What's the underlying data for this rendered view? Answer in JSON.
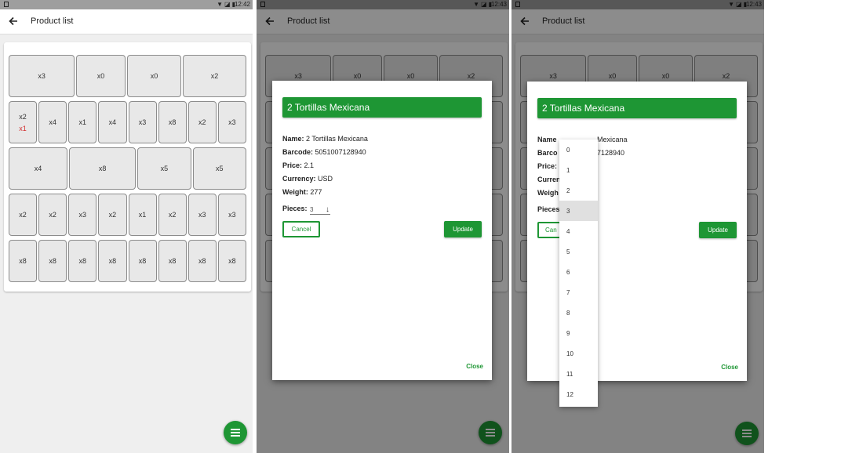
{
  "status_bar": {
    "time1": "12:42",
    "time2": "12:43",
    "time3": "12:43"
  },
  "app_bar": {
    "title": "Product list"
  },
  "grid": {
    "row1": [
      "x3",
      "x0",
      "x0",
      "x2"
    ],
    "row2_first": {
      "top": "x2",
      "bottom": "x1"
    },
    "row2_rest": [
      "x4",
      "x1",
      "x4",
      "x3",
      "x8",
      "x2",
      "x3"
    ],
    "row3": [
      "x4",
      "x8",
      "x5",
      "x5"
    ],
    "row4": [
      "x2",
      "x2",
      "x3",
      "x2",
      "x1",
      "x2",
      "x3",
      "x3"
    ],
    "row5": [
      "x8",
      "x8",
      "x8",
      "x8",
      "x8",
      "x8",
      "x8",
      "x8"
    ]
  },
  "dialog": {
    "title": "2 Tortillas Mexicana",
    "name_label": "Name:",
    "name_value": "2 Tortillas Mexicana",
    "barcode_label": "Barcode:",
    "barcode_value": "5051007128940",
    "price_label": "Price:",
    "price_value": "2.1",
    "currency_label": "Currency:",
    "currency_value": "USD",
    "weight_label": "Weight:",
    "weight_value": "277",
    "pieces_label": "Pieces:",
    "pieces_value": "3",
    "cancel_label": "Cancel",
    "update_label": "Update",
    "close_label": "Close"
  },
  "dialog3": {
    "title": "2 Tortillas Mexicana",
    "name_label": "Name",
    "name_partial": "Mexicana",
    "barcode_label": "Barco",
    "barcode_partial": "7128940",
    "price_label": "Price:",
    "currency_label": "Curren",
    "weight_label": "Weigh",
    "pieces_label": "Pieces",
    "cancel_label": "Can",
    "update_label": "Update",
    "close_label": "Close"
  },
  "pieces_options": [
    "0",
    "1",
    "2",
    "3",
    "4",
    "5",
    "6",
    "7",
    "8",
    "9",
    "10",
    "11",
    "12"
  ],
  "pieces_selected": "3",
  "colors": {
    "accent": "#1e9634",
    "warning": "#d32f2f"
  }
}
